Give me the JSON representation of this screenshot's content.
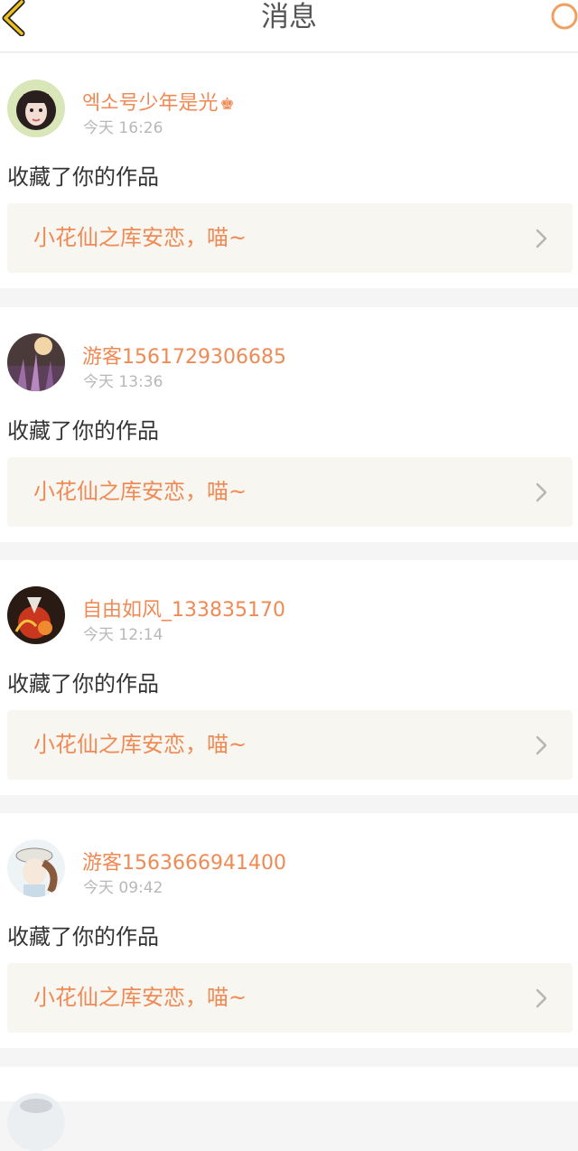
{
  "header": {
    "title": "消息",
    "back_icon": "back-chevron-icon",
    "search_icon": "search-icon",
    "accent": "#f0a060"
  },
  "notifications": [
    {
      "username": "엑소号少年是光",
      "badge_icon": "crown-icon",
      "time": "今天 16:26",
      "action": "收藏了你的作品",
      "work_title": "小花仙之库安恋，喵~"
    },
    {
      "username": "游客1561729306685",
      "time": "今天 13:36",
      "action": "收藏了你的作品",
      "work_title": "小花仙之库安恋，喵~"
    },
    {
      "username": "自由如风_133835170",
      "time": "今天 12:14",
      "action": "收藏了你的作品",
      "work_title": "小花仙之库安恋，喵~"
    },
    {
      "username": "游客1563666941400",
      "time": "今天 09:42",
      "action": "收藏了你的作品",
      "work_title": "小花仙之库安恋，喵~"
    }
  ],
  "colors": {
    "name": "#f08a55",
    "link_bg": "#f7f6f1",
    "separator": "#f5f5f5"
  }
}
